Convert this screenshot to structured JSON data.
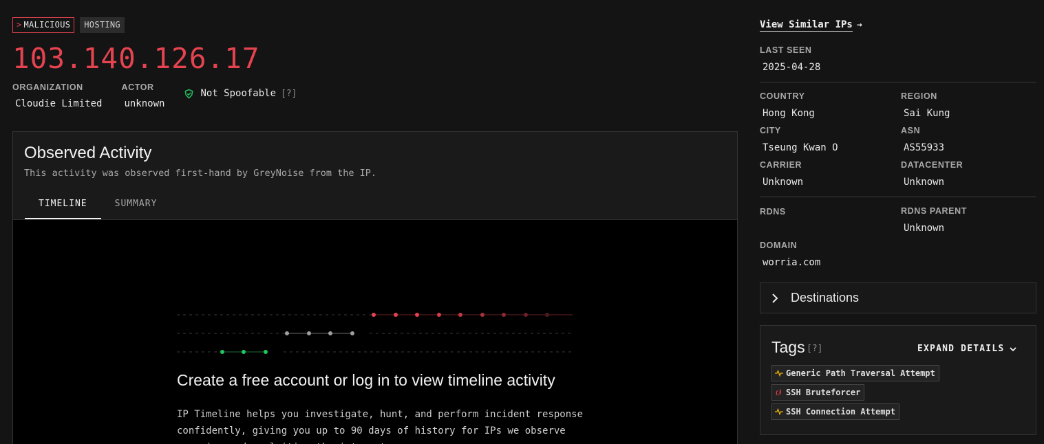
{
  "header": {
    "badges": {
      "malicious": "MALICIOUS",
      "malicious_prefix": ">",
      "hosting": "HOSTING"
    },
    "ip": "103.140.126.17",
    "organization_label": "ORGANIZATION",
    "organization": "Cloudie Limited",
    "actor_label": "ACTOR",
    "actor": "unknown",
    "spoofable": "Not Spoofable",
    "help": "[?]"
  },
  "activity": {
    "title": "Observed Activity",
    "subtitle": "This activity was observed first-hand by GreyNoise from the IP.",
    "tabs": [
      {
        "label": "TIMELINE",
        "active": true
      },
      {
        "label": "SUMMARY",
        "active": false
      }
    ],
    "cta_title": "Create a free account or log in to view timeline activity",
    "cta_text": "IP Timeline helps you investigate, hunt, and perform incident response confidently, giving you up to 90 days of history for IPs we observe scanning and exploiting the internet."
  },
  "sidebar": {
    "view_similar": "View Similar IPs",
    "view_similar_arrow": "→",
    "last_seen_label": "LAST SEEN",
    "last_seen": "2025-04-28",
    "country_label": "COUNTRY",
    "country": "Hong Kong",
    "region_label": "REGION",
    "region": "Sai Kung",
    "city_label": "CITY",
    "city": "Tseung Kwan O",
    "asn_label": "ASN",
    "asn": "AS55933",
    "carrier_label": "CARRIER",
    "carrier": "Unknown",
    "datacenter_label": "DATACENTER",
    "datacenter": "Unknown",
    "rdns_label": "RDNS",
    "rdns_parent_label": "RDNS PARENT",
    "rdns_parent": "Unknown",
    "domain_label": "DOMAIN",
    "domain": "worria.com",
    "destinations": "Destinations",
    "tags_title": "Tags",
    "tags_help": "[?]",
    "expand_details": "EXPAND DETAILS",
    "tags": [
      {
        "label": "Generic Path Traversal Attempt",
        "icon": "activity-icon"
      },
      {
        "label": "SSH Bruteforcer",
        "icon": "malicious-icon"
      },
      {
        "label": "SSH Connection Attempt",
        "icon": "activity-icon"
      }
    ]
  },
  "colors": {
    "malicious": "#e5434f",
    "benign": "#22c55e",
    "neutral": "#9a9a9a",
    "suspicious": "#eab308"
  }
}
